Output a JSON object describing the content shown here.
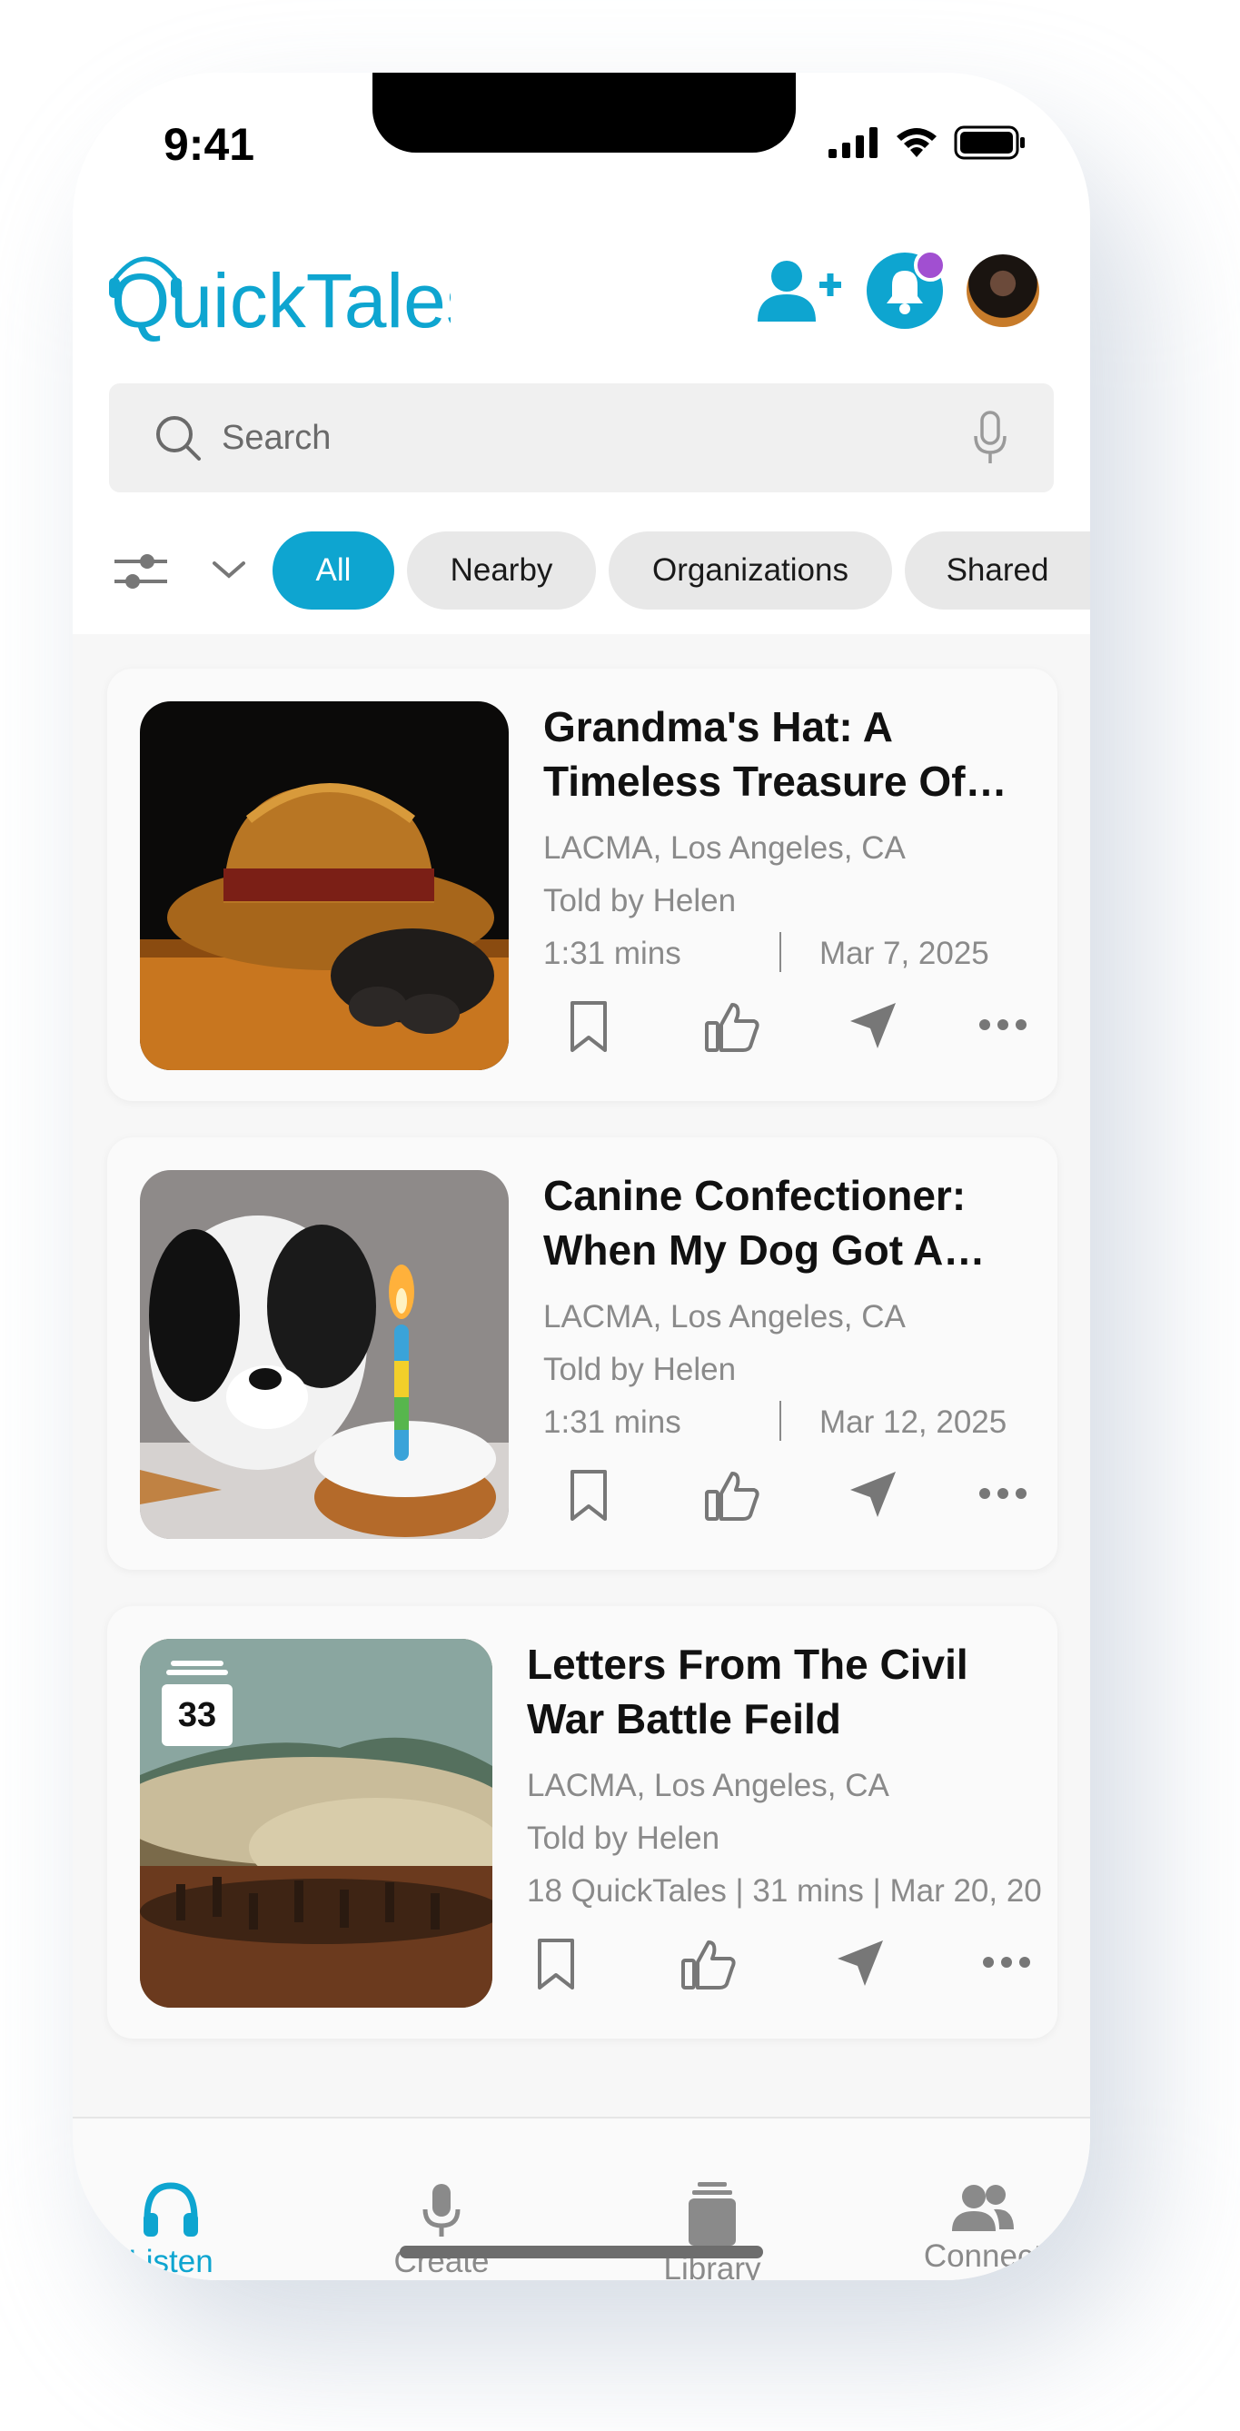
{
  "status": {
    "time": "9:41"
  },
  "app": {
    "brand": "QuickTales",
    "accent": "#0ea5d0",
    "notification_dot_color": "#a14fd1"
  },
  "search": {
    "placeholder": "Search"
  },
  "filters": {
    "items": [
      {
        "label": "All",
        "active": true
      },
      {
        "label": "Nearby",
        "active": false
      },
      {
        "label": "Organizations",
        "active": false
      },
      {
        "label": "Shared",
        "active": false
      }
    ]
  },
  "stories": [
    {
      "title": "Grandma's Hat: A Timeless Treasure Of…",
      "location": "LACMA, Los Angeles, CA",
      "teller": "Told by Helen",
      "duration": "1:31 mins",
      "date": "Mar 7, 2025"
    },
    {
      "title": "Canine Confectioner: When My Dog Got A…",
      "location": "LACMA, Los Angeles, CA",
      "teller": "Told by Helen",
      "duration": "1:31 mins",
      "date": "Mar 12, 2025"
    },
    {
      "title": "Letters From The Civil War Battle Feild",
      "location": "LACMA, Los Angeles, CA",
      "teller": "Told by Helen",
      "summary": "18 QuickTales | 31 mins | Mar 20, 20",
      "collection_count": "33"
    }
  ],
  "tabs": [
    {
      "label": "Listen",
      "icon": "headphones-icon",
      "active": true
    },
    {
      "label": "Create",
      "icon": "microphone-icon",
      "active": false
    },
    {
      "label": "Library",
      "icon": "library-icon",
      "active": false
    },
    {
      "label": "Connect",
      "icon": "people-icon",
      "active": false
    }
  ]
}
